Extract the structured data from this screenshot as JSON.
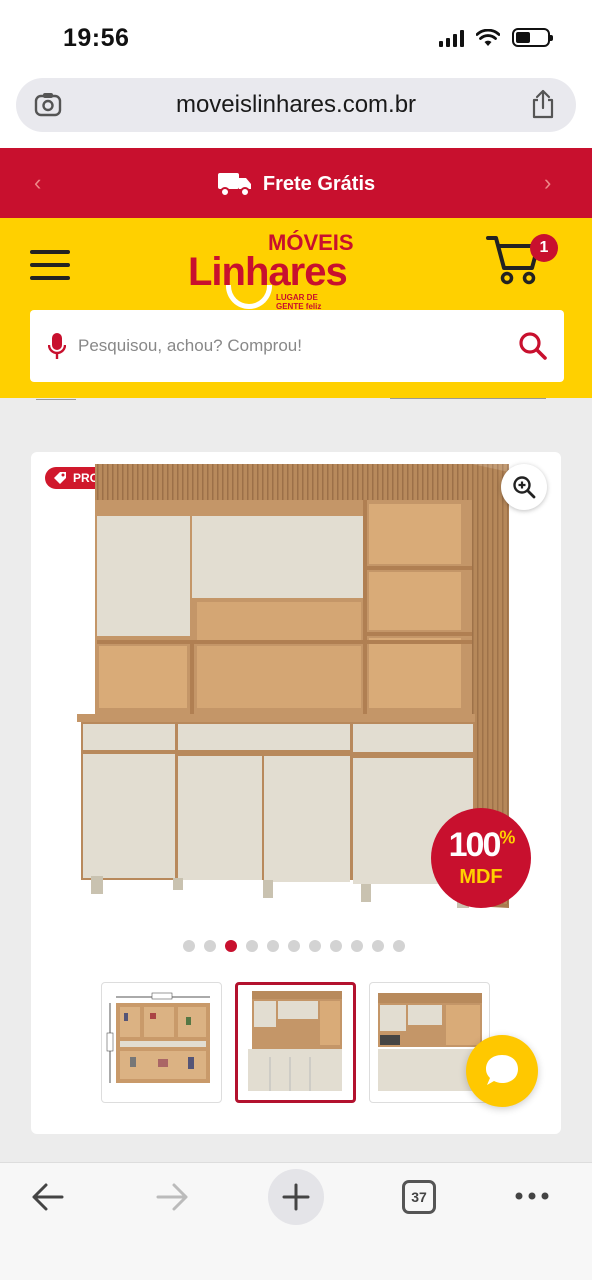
{
  "status_bar": {
    "time": "19:56"
  },
  "browser": {
    "url": "moveislinhares.com.br",
    "tab_count": "37"
  },
  "banner": {
    "text": "Frete Grátis"
  },
  "header": {
    "logo_top": "MÓVEIS",
    "logo_main": "Linhares",
    "logo_tagline_1": "LUGAR DE",
    "logo_tagline_2": "GENTE feliz",
    "cart_count": "1"
  },
  "search": {
    "placeholder": "Pesquisou, achou? Comprou!"
  },
  "product": {
    "promo_badge": "PROMOÇÃO",
    "mdf_percent": "100",
    "mdf_percent_sign": "%",
    "mdf_label": "MDF",
    "gallery_total": 11,
    "gallery_active": 3
  },
  "colors": {
    "brand_red": "#c8102e",
    "brand_yellow": "#ffd000"
  }
}
